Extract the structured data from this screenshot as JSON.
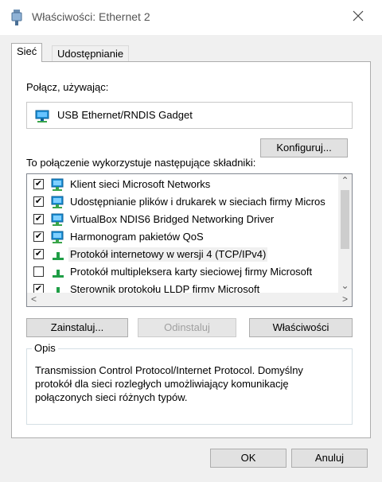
{
  "window": {
    "title": "Właściwości: Ethernet 2"
  },
  "tabs": [
    {
      "label": "Sieć"
    },
    {
      "label": "Udostępnianie"
    }
  ],
  "connect": {
    "label": "Połącz, używając:",
    "adapter": "USB Ethernet/RNDIS Gadget",
    "configure_label": "Konfiguruj..."
  },
  "components": {
    "label": "To połączenie wykorzystuje następujące składniki:",
    "items": [
      {
        "label": "Klient sieci Microsoft Networks",
        "checked": true,
        "icon": "network-client-icon"
      },
      {
        "label": "Udostępnianie plików i drukarek w sieciach firmy Micros",
        "checked": true,
        "icon": "network-client-icon"
      },
      {
        "label": "VirtualBox NDIS6 Bridged Networking Driver",
        "checked": true,
        "icon": "network-client-icon"
      },
      {
        "label": "Harmonogram pakietów QoS",
        "checked": true,
        "icon": "network-client-icon"
      },
      {
        "label": "Protokół internetowy w wersji 4 (TCP/IPv4)",
        "checked": true,
        "icon": "protocol-icon",
        "selected": true
      },
      {
        "label": "Protokół multipleksera karty sieciowej firmy Microsoft",
        "checked": false,
        "icon": "protocol-icon"
      },
      {
        "label": "Sterownik protokołu LLDP firmy Microsoft",
        "checked": true,
        "icon": "protocol-icon"
      }
    ]
  },
  "buttons": {
    "install": "Zainstaluj...",
    "uninstall": "Odinstaluj",
    "properties": "Właściwości",
    "ok": "OK",
    "cancel": "Anuluj"
  },
  "description": {
    "legend": "Opis",
    "text": "Transmission Control Protocol/Internet Protocol. Domyślny protokół dla sieci rozległych umożliwiający komunikację połączonych sieci różnych typów."
  },
  "colors": {
    "accent": "#0078d7",
    "protocol_green": "#1f9e46"
  }
}
